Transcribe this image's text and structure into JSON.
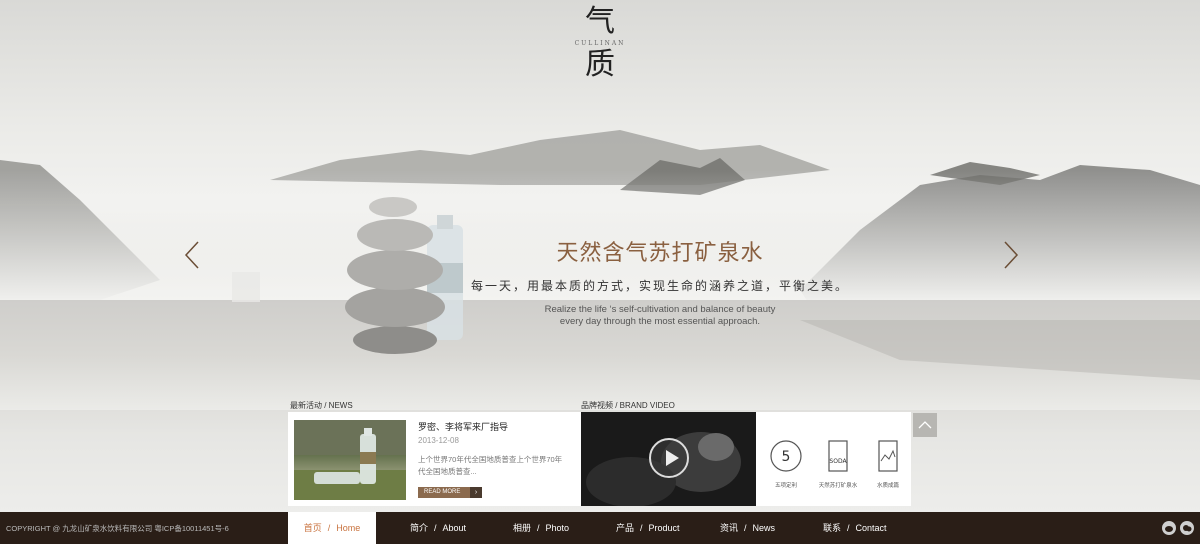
{
  "logo": {
    "top": "气",
    "en": "CULLINAN",
    "bottom": "质"
  },
  "hero": {
    "title": "天然含气苏打矿泉水",
    "subtitle": "每一天，用最本质的方式，实现生命的涵养之道，平衡之美。",
    "en_line1": "Realize the life ‘s self-cultivation and balance of beauty",
    "en_line2": "every day through the most essential approach."
  },
  "news": {
    "section_label": "最新活动 / NEWS",
    "title": "罗密、李将军来厂指导",
    "date": "2013-12-08",
    "desc": "上个世界70年代全国地质普查上个世界70年代全国地质普查...",
    "read_more": "READ MORE"
  },
  "video": {
    "section_label": "品牌视频 / BRAND VIDEO"
  },
  "brand": {
    "badge1_caption": "五项定利",
    "badge2_caption": "天然苏打矿泉水",
    "badge3_caption": "水质成篇",
    "badge2_text": "SODA"
  },
  "footer": {
    "copyright": "COPYRIGHT @ 九龙山矿泉水饮料有限公司    粤ICP备10011451号-6",
    "nav": [
      {
        "cn": "首页",
        "en": "Home"
      },
      {
        "cn": "简介",
        "en": "About"
      },
      {
        "cn": "相册",
        "en": "Photo"
      },
      {
        "cn": "产品",
        "en": "Product"
      },
      {
        "cn": "资讯",
        "en": "News"
      },
      {
        "cn": "联系",
        "en": "Contact"
      }
    ],
    "separator": "/"
  },
  "colors": {
    "accent": "#c8723e",
    "footer_bg": "#2a1e17",
    "read_more": "#8b6a4e"
  }
}
